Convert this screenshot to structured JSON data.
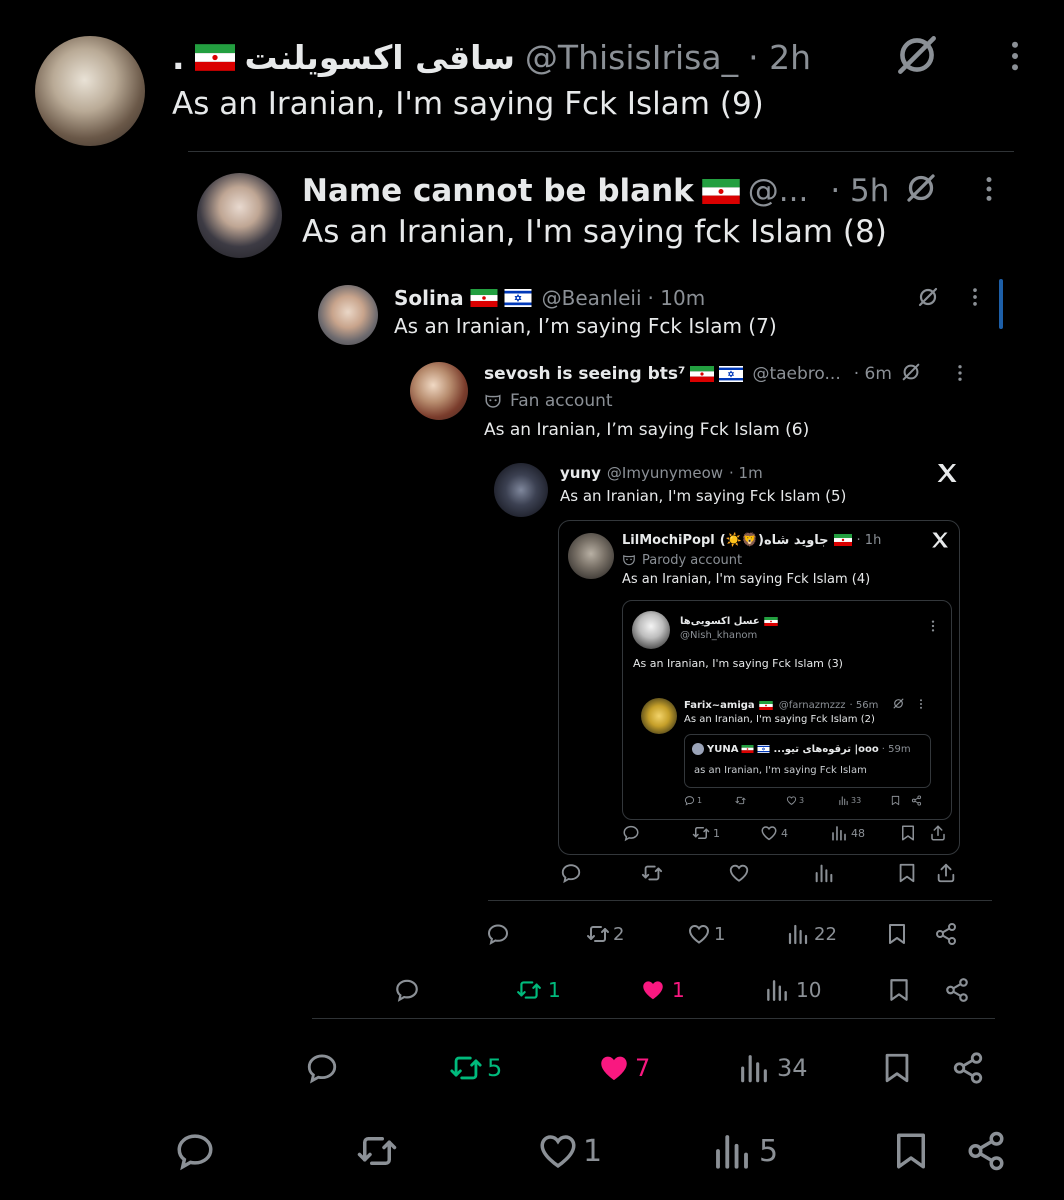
{
  "colors": {
    "bg": "#000000",
    "text": "#e7e9ea",
    "muted": "#8b9096",
    "retweet": "#00ba7c",
    "like": "#f91880"
  },
  "t1": {
    "dot": ".",
    "name": "ساقی اکسویلنت",
    "handle": "@ThisisIrisa_",
    "time": "· 2h",
    "text": "As an Iranian, I'm saying Fck Islam (9)",
    "actions": {
      "reply": "",
      "retweet": "",
      "like": "1",
      "views": "5"
    }
  },
  "t2": {
    "name": "Name cannot be blank",
    "handle": "@...",
    "time": "· 5h",
    "text": "As an Iranian, I'm saying fck Islam (8)",
    "actions": {
      "reply": "",
      "retweet": "5",
      "like": "7",
      "views": "34"
    }
  },
  "t3": {
    "name": "Solina",
    "handle": "@Beanleii",
    "time": "· 10m",
    "text": "As an Iranian, I’m saying Fck Islam (7)",
    "actions": {
      "reply": "",
      "retweet": "1",
      "like": "1",
      "views": "10"
    }
  },
  "t4": {
    "name": "sevosh is seeing bts⁷",
    "handle": "@taebro...",
    "time": "· 6m",
    "label": "Fan account",
    "text": "As an Iranian, I’m saying Fck Islam (6)",
    "actions": {
      "reply": "",
      "retweet": "2",
      "like": "1",
      "views": "22"
    }
  },
  "t5": {
    "name": "yuny",
    "handle": "@Imyunymeow",
    "time": "· 1m",
    "text": "As an Iranian, I'm saying Fck Islam (5)",
    "actions": {
      "reply": "",
      "retweet": "",
      "like": "",
      "views": ""
    }
  },
  "t6": {
    "name": "LilMochiPopl",
    "name_extra": "جاوید شاه(🦁☀️)",
    "time": "· 1h",
    "label": "Parody account",
    "text": "As an Iranian, I'm saying Fck Islam (4)",
    "actions": {
      "reply": "",
      "retweet": "1",
      "like": "4",
      "views": "48"
    }
  },
  "t7": {
    "name": "عسل اکسویی‌ها",
    "handle": "@Nish_khanom",
    "text": "As an Iranian, I'm saying Fck Islam (3)"
  },
  "t8": {
    "name": "Farix~amiga",
    "handle": "@farnazmzzz",
    "time": "· 56m",
    "text": "As an Iranian, I'm saying Fck Islam (2)"
  },
  "t9": {
    "name": "YUNA",
    "name_extra": "ooo| ترقوه‌های تیو...",
    "time": "· 59m",
    "text": "as an Iranian, I'm saying Fck Islam",
    "actions": {
      "reply": "1",
      "retweet": "",
      "like": "3",
      "views": "33"
    }
  }
}
